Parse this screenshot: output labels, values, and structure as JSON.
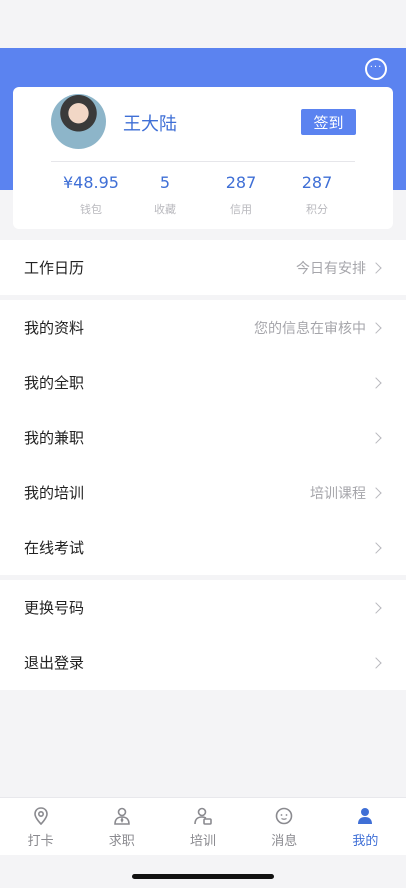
{
  "profile": {
    "username": "王大陆",
    "checkin_label": "签到",
    "stats": [
      {
        "value": "¥48.95",
        "label": "钱包"
      },
      {
        "value": "5",
        "label": "收藏"
      },
      {
        "value": "287",
        "label": "信用"
      },
      {
        "value": "287",
        "label": "积分"
      }
    ]
  },
  "menu": {
    "group1": [
      {
        "title": "工作日历",
        "detail": "今日有安排"
      }
    ],
    "group2": [
      {
        "title": "我的资料",
        "detail": "您的信息在审核中"
      },
      {
        "title": "我的全职",
        "detail": ""
      },
      {
        "title": "我的兼职",
        "detail": ""
      },
      {
        "title": "我的培训",
        "detail": "培训课程"
      },
      {
        "title": "在线考试",
        "detail": ""
      }
    ],
    "group3": [
      {
        "title": "更换号码",
        "detail": ""
      },
      {
        "title": "退出登录",
        "detail": ""
      }
    ]
  },
  "tabbar": {
    "items": [
      {
        "label": "打卡",
        "icon": "location-icon",
        "active": false
      },
      {
        "label": "求职",
        "icon": "job-icon",
        "active": false
      },
      {
        "label": "培训",
        "icon": "training-icon",
        "active": false
      },
      {
        "label": "消息",
        "icon": "message-icon",
        "active": false
      },
      {
        "label": "我的",
        "icon": "profile-icon",
        "active": true
      }
    ]
  },
  "colors": {
    "accent": "#5b83f0",
    "accent_text": "#3f6fd6",
    "background": "#f4f4f6"
  }
}
